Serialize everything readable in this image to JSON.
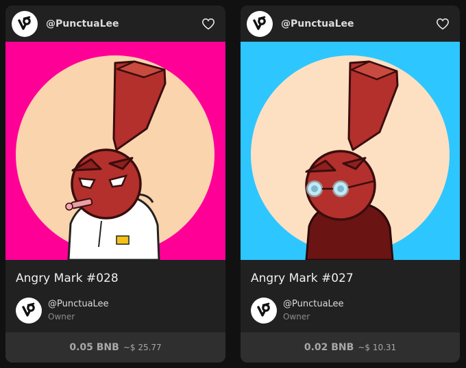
{
  "cards": [
    {
      "handle": "@PunctuaLee",
      "title": "Angry Mark #028",
      "owner_name": "@PunctuaLee",
      "owner_role": "Owner",
      "price_crypto": "0.05 BNB",
      "price_fiat": "~$ 25.77",
      "art": {
        "background": "#ff0097",
        "circle": "#f9d4ad",
        "outfit": "white-hoodie",
        "accessory": "cigar"
      }
    },
    {
      "handle": "@PunctuaLee",
      "title": "Angry Mark #027",
      "owner_name": "@PunctuaLee",
      "owner_role": "Owner",
      "price_crypto": "0.02 BNB",
      "price_fiat": "~$ 10.31",
      "art": {
        "background": "#2ec6ff",
        "circle": "#fde0c2",
        "outfit": "dark-red-shirt",
        "accessory": "glasses"
      }
    }
  ],
  "icons": {
    "avatar": "punctualee-logo-icon",
    "like": "heart-outline-icon"
  },
  "colors": {
    "card_bg": "#212121",
    "price_bar_bg": "#2f2f2f",
    "page_bg": "#111111",
    "head_red": "#b3302c"
  }
}
